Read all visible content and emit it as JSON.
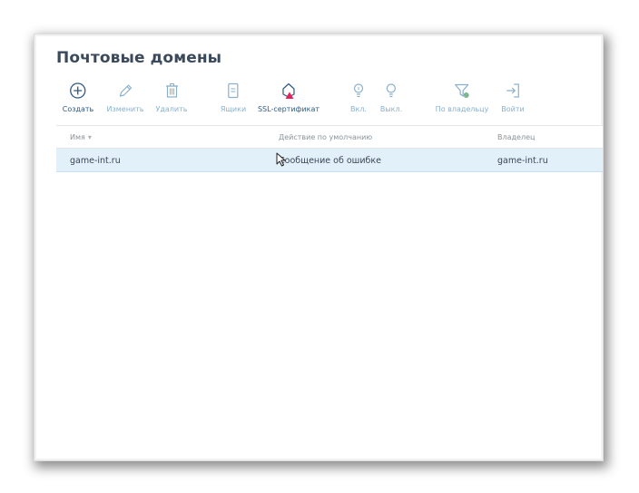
{
  "page": {
    "title": "Почтовые домены"
  },
  "toolbar": {
    "items": [
      {
        "label": "Создать",
        "icon": "plus-circle-icon",
        "active": true
      },
      {
        "label": "Изменить",
        "icon": "pencil-icon",
        "active": false
      },
      {
        "label": "Удалить",
        "icon": "trash-icon",
        "active": false
      },
      {
        "label": "Ящики",
        "icon": "mailbox-icon",
        "active": false
      },
      {
        "label": "SSL-сертификат",
        "icon": "ssl-certificate-warning-icon",
        "active": true
      },
      {
        "label": "Вкл.",
        "icon": "lightbulb-on-icon",
        "active": false
      },
      {
        "label": "Выкл.",
        "icon": "lightbulb-off-icon",
        "active": false
      },
      {
        "label": "По владельцу",
        "icon": "filter-icon",
        "active": false
      },
      {
        "label": "Войти",
        "icon": "login-icon",
        "active": false
      }
    ]
  },
  "table": {
    "columns": [
      {
        "label": "Имя",
        "sort": "▾"
      },
      {
        "label": "Действие по умолчанию"
      },
      {
        "label": "Владелец"
      }
    ],
    "rows": [
      {
        "name": "game-int.ru",
        "default_action": "Сообщение об ошибке",
        "owner": "game-int.ru",
        "selected": true
      }
    ]
  },
  "colors": {
    "accent": "#2d5a84",
    "icon_inactive": "#8ab0cc",
    "warning": "#e0245e",
    "selected_row": "#e2f0fa"
  }
}
